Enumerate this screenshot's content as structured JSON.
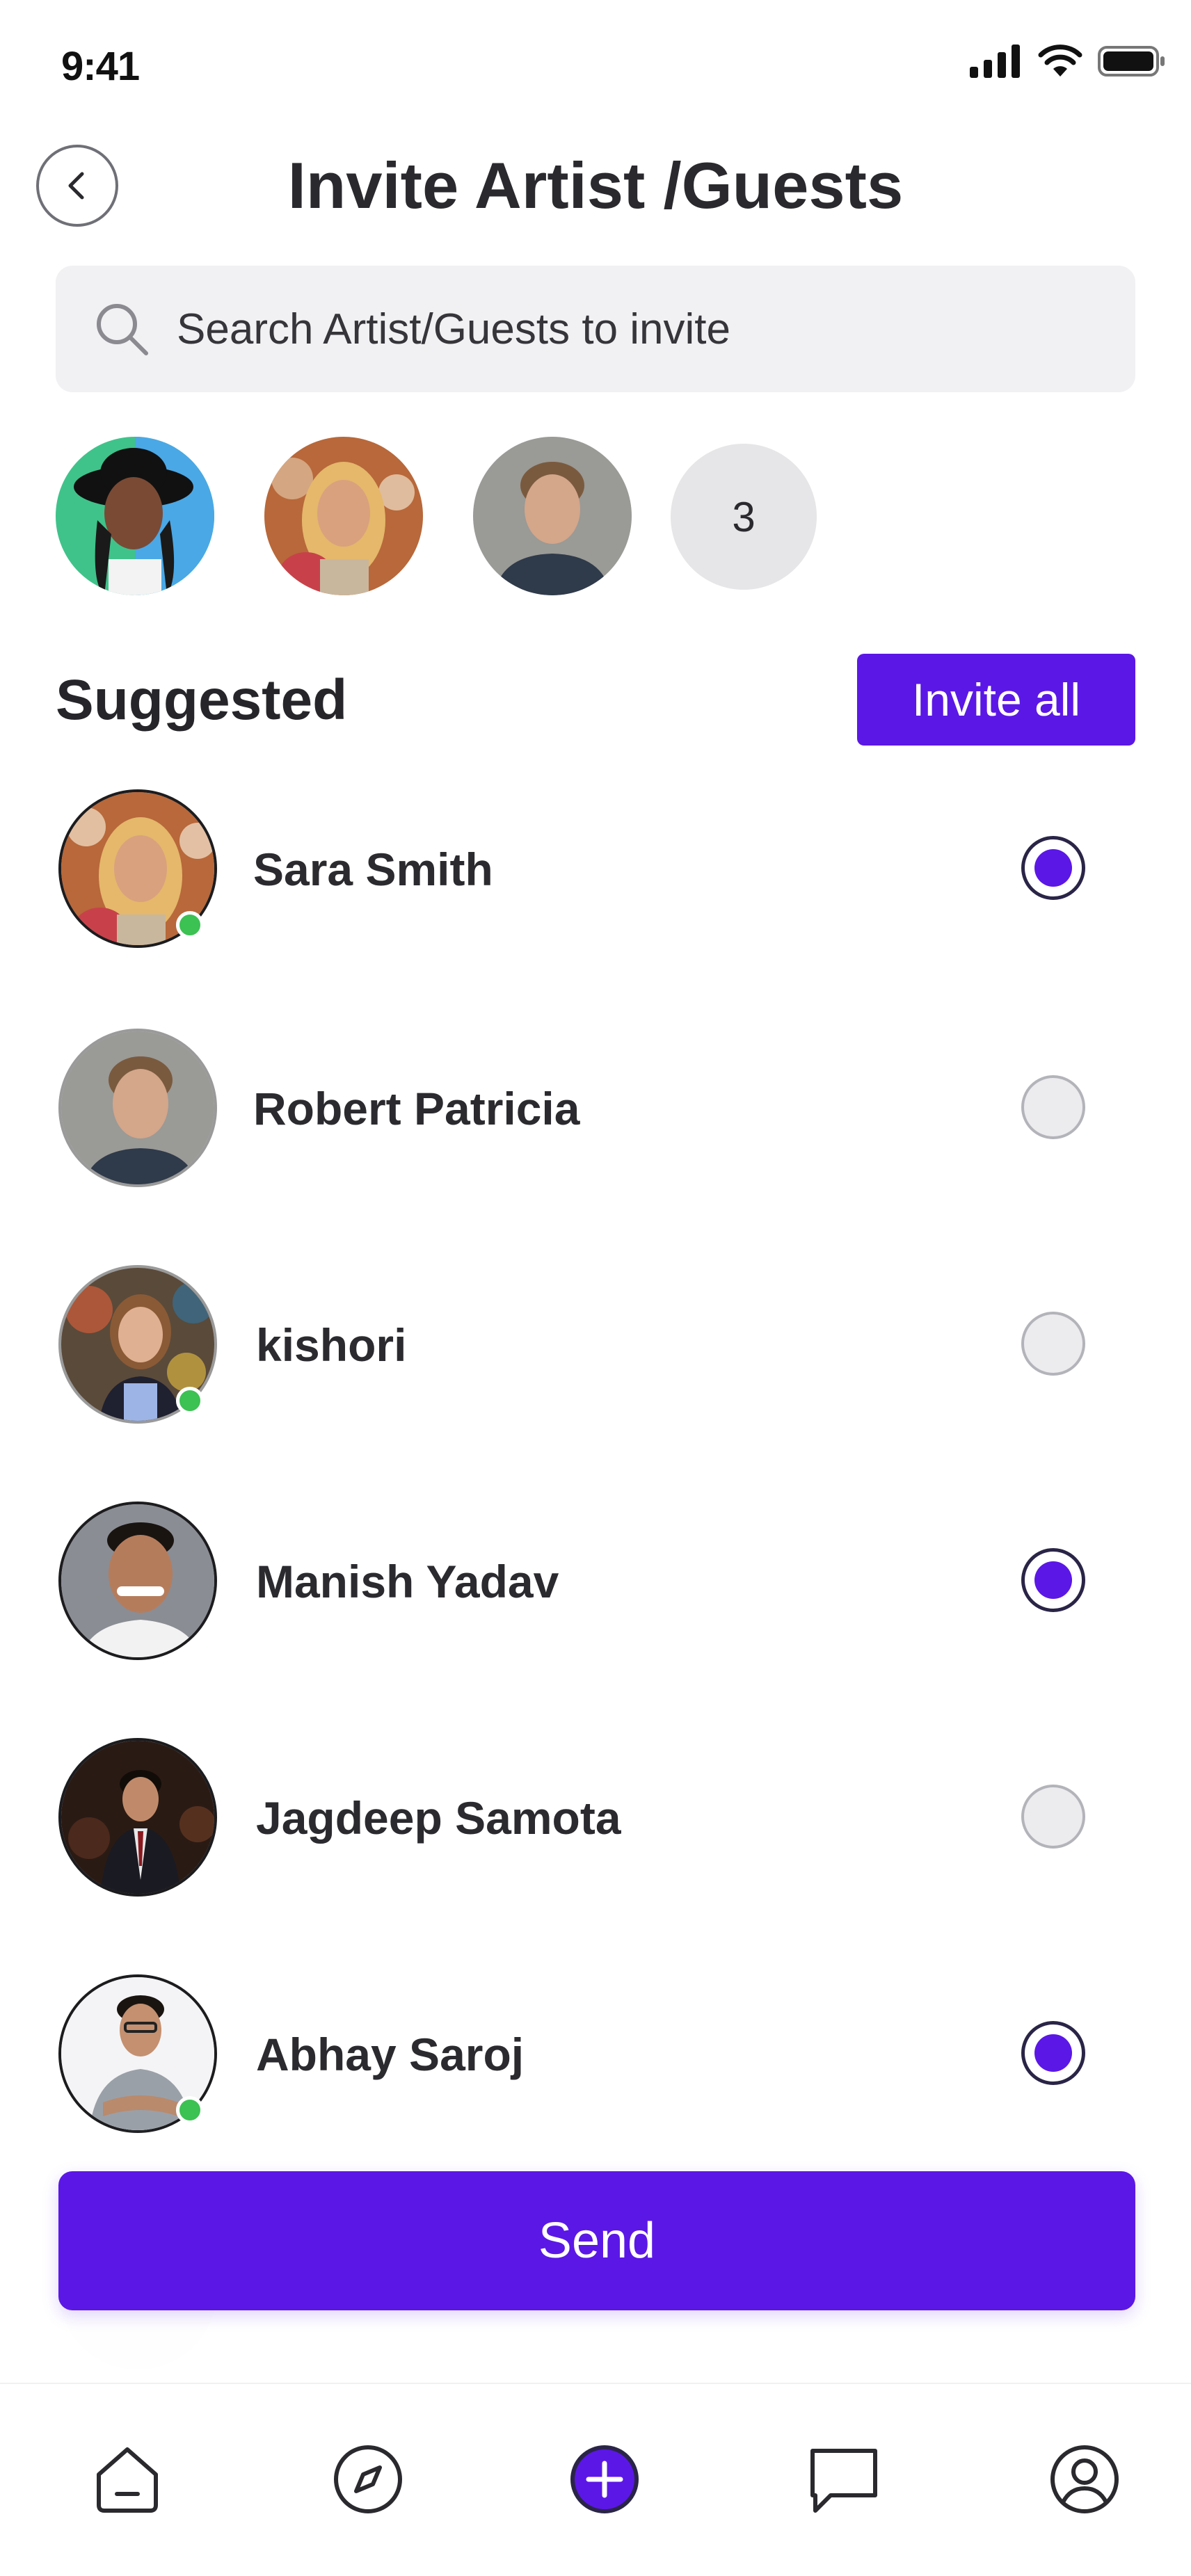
{
  "status_bar": {
    "time": "9:41"
  },
  "header": {
    "title": "Invite Artist /Guests"
  },
  "search": {
    "placeholder": "Search Artist/Guests to invite"
  },
  "selected": {
    "avatars": [
      {
        "name": "guest-avatar-1",
        "color": "#3fc38a"
      },
      {
        "name": "guest-avatar-2",
        "color": "#b8683a"
      },
      {
        "name": "guest-avatar-3",
        "color": "#8d8d8d"
      }
    ],
    "more_count": "3"
  },
  "suggested": {
    "title": "Suggested",
    "invite_all_label": "Invite all"
  },
  "contacts": [
    {
      "name": "Sara Smith",
      "online": true,
      "selected": true
    },
    {
      "name": "Robert Patricia",
      "online": false,
      "selected": false
    },
    {
      "name": "kishori",
      "online": true,
      "selected": false
    },
    {
      "name": "Manish Yadav",
      "online": false,
      "selected": true
    },
    {
      "name": "Jagdeep Samota",
      "online": false,
      "selected": false
    },
    {
      "name": "Abhay Saroj",
      "online": true,
      "selected": true
    }
  ],
  "actions": {
    "send_label": "Send"
  },
  "bottom_nav": {
    "items": [
      {
        "icon": "home-icon"
      },
      {
        "icon": "compass-icon"
      },
      {
        "icon": "plus-circle-icon"
      },
      {
        "icon": "chat-icon"
      },
      {
        "icon": "profile-icon"
      }
    ]
  },
  "colors": {
    "accent": "#5b17e6",
    "online": "#3cc153"
  }
}
